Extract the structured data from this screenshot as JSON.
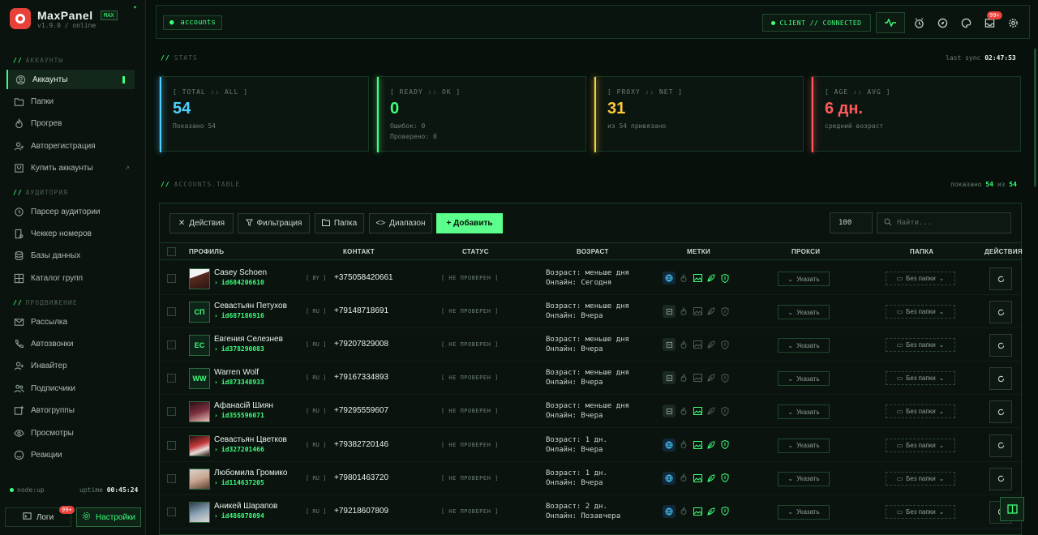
{
  "app": {
    "name": "MaxPanel",
    "badge": "MAX",
    "version": "v1.9.0 / online"
  },
  "sidebar": {
    "sections": [
      {
        "title": "АККАУНТЫ",
        "items": [
          {
            "label": "Аккаунты",
            "icon": "user-circle-icon",
            "active": true
          },
          {
            "label": "Папки",
            "icon": "folder-icon"
          },
          {
            "label": "Прогрев",
            "icon": "flame-icon"
          },
          {
            "label": "Авторегистрация",
            "icon": "user-add-icon"
          },
          {
            "label": "Купить аккаунты",
            "icon": "cart-icon",
            "external": true
          }
        ]
      },
      {
        "title": "АУДИТОРИЯ",
        "items": [
          {
            "label": "Парсер аудитории",
            "icon": "history-icon"
          },
          {
            "label": "Чеккер номеров",
            "icon": "phone-search-icon"
          },
          {
            "label": "Базы данных",
            "icon": "database-icon"
          },
          {
            "label": "Каталог групп",
            "icon": "grid-icon"
          }
        ]
      },
      {
        "title": "ПРОДВИЖЕНИЕ",
        "items": [
          {
            "label": "Рассылка",
            "icon": "mail-icon"
          },
          {
            "label": "Автозвонки",
            "icon": "phone-icon"
          },
          {
            "label": "Инвайтер",
            "icon": "user-plus-icon"
          },
          {
            "label": "Подписчики",
            "icon": "users-icon"
          },
          {
            "label": "Автогруппы",
            "icon": "group-add-icon"
          },
          {
            "label": "Просмотры",
            "icon": "eye-icon"
          },
          {
            "label": "Реакции",
            "icon": "smile-icon"
          }
        ]
      }
    ],
    "node_status": "node:up",
    "uptime_label": "uptime",
    "uptime_value": "00:45:24",
    "logs_label": "Логи",
    "logs_badge": "99+",
    "settings_label": "Настройки"
  },
  "header": {
    "crumb": "accounts",
    "connection": "CLIENT // CONNECTED",
    "notif_badge": "99+"
  },
  "stats": {
    "title": "STATS",
    "last_sync_label": "last sync",
    "last_sync_value": "02:47:53",
    "cards": [
      {
        "label": "[ TOTAL :: ALL ]",
        "value": "54",
        "sub1": "Показано 54",
        "sub2": "",
        "color": "#4fd0ff"
      },
      {
        "label": "[ READY :: OK ]",
        "value": "0",
        "sub1": "Ошибок: 0",
        "sub2": "Проверено: 0",
        "color": "#3dff7a"
      },
      {
        "label": "[ PROXY :: NET ]",
        "value": "31",
        "sub1": "из 54 привязано",
        "sub2": "",
        "color": "#ffc83d"
      },
      {
        "label": "[ AGE :: AVG ]",
        "value": "6 дн.",
        "sub1": "средний возраст",
        "sub2": "",
        "color": "#ff5a5a"
      }
    ]
  },
  "table": {
    "title": "ACCOUNTS.TABLE",
    "shown_label": "показано",
    "shown_count": "54",
    "of_label": "из",
    "total_count": "54",
    "toolbar": {
      "actions": "Действия",
      "filter": "Фильтрация",
      "folder": "Папка",
      "range": "Диапазон",
      "add": "+ Добавить",
      "per_page": "100",
      "search_placeholder": "Найти..."
    },
    "columns": [
      "ПРОФИЛЬ",
      "КОНТАКТ",
      "СТАТУС",
      "ВОЗРАСТ",
      "МЕТКИ",
      "ПРОКСИ",
      "ПАПКА",
      "ДЕЙСТВИЯ"
    ],
    "rows": [
      {
        "name": "Casey Schoen",
        "id": "id684206610",
        "initials": "",
        "photo": true,
        "cc": "[ BY ]",
        "phone": "+375058420661",
        "status": "[ НЕ ПРОВЕРЕН ]",
        "age": "Возраст: меньше дня",
        "online": "Онлайн: Сегодня",
        "tags": [
          true,
          false,
          true,
          true,
          true
        ]
      },
      {
        "name": "Севастьян Петухов",
        "id": "id687186916",
        "initials": "СП",
        "photo": false,
        "cc": "[ RU ]",
        "phone": "+79148718691",
        "status": "[ НЕ ПРОВЕРЕН ]",
        "age": "Возраст: меньше дня",
        "online": "Онлайн: Вчера",
        "tags": [
          false,
          false,
          false,
          false,
          false
        ]
      },
      {
        "name": "Евгения Селезнев",
        "id": "id378290083",
        "initials": "ЕС",
        "photo": false,
        "cc": "[ RU ]",
        "phone": "+79207829008",
        "status": "[ НЕ ПРОВЕРЕН ]",
        "age": "Возраст: меньше дня",
        "online": "Онлайн: Вчера",
        "tags": [
          false,
          false,
          false,
          false,
          false
        ]
      },
      {
        "name": "Warren Wolf",
        "id": "id873348933",
        "initials": "WW",
        "photo": false,
        "cc": "[ RU ]",
        "phone": "+79167334893",
        "status": "[ НЕ ПРОВЕРЕН ]",
        "age": "Возраст: меньше дня",
        "online": "Онлайн: Вчера",
        "tags": [
          false,
          false,
          false,
          false,
          false
        ]
      },
      {
        "name": "Афанасій Шиян",
        "id": "id355596071",
        "initials": "",
        "photo": true,
        "cc": "[ RU ]",
        "phone": "+79295559607",
        "status": "[ НЕ ПРОВЕРЕН ]",
        "age": "Возраст: меньше дня",
        "online": "Онлайн: Вчера",
        "tags": [
          false,
          false,
          true,
          false,
          false
        ]
      },
      {
        "name": "Севастьян Цветков",
        "id": "id327201466",
        "initials": "",
        "photo": true,
        "cc": "[ RU ]",
        "phone": "+79382720146",
        "status": "[ НЕ ПРОВЕРЕН ]",
        "age": "Возраст: 1 дн.",
        "online": "Онлайн: Вчера",
        "tags": [
          true,
          false,
          true,
          true,
          true
        ]
      },
      {
        "name": "Любомила Громико",
        "id": "id114637205",
        "initials": "",
        "photo": true,
        "cc": "[ RU ]",
        "phone": "+79801463720",
        "status": "[ НЕ ПРОВЕРЕН ]",
        "age": "Возраст: 1 дн.",
        "online": "Онлайн: Вчера",
        "tags": [
          true,
          false,
          true,
          true,
          true
        ]
      },
      {
        "name": "Аникей Шарапов",
        "id": "id486078094",
        "initials": "",
        "photo": true,
        "cc": "[ RU ]",
        "phone": "+79218607809",
        "status": "[ НЕ ПРОВЕРЕН ]",
        "age": "Возраст: 2 дн.",
        "online": "Онлайн: Позавчера",
        "tags": [
          true,
          false,
          true,
          true,
          true
        ]
      }
    ],
    "proxy_label": "Указать",
    "folder_label": "Без папки"
  }
}
